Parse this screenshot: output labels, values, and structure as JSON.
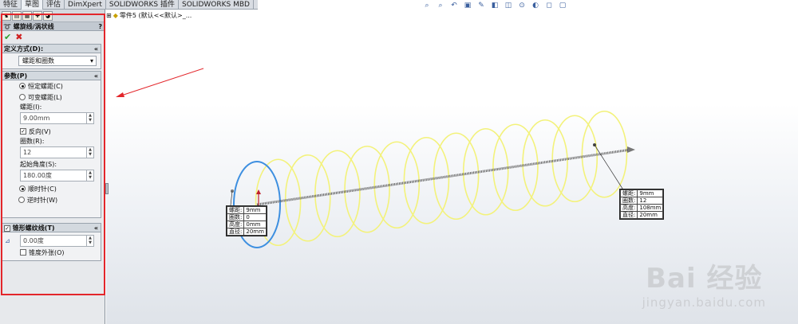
{
  "tabs": [
    "特征",
    "草图",
    "评估",
    "DimXpert",
    "SOLIDWORKS 插件",
    "SOLIDWORKS MBD"
  ],
  "feature_tree_label": "零件5 (默认<<默认>_...",
  "property_manager": {
    "title": "螺旋线/涡状线",
    "help": "?",
    "definition": {
      "header": "定义方式(D):",
      "collapse": "«",
      "selected": "螺距和圈数"
    },
    "params": {
      "header": "参数(P)",
      "collapse": "«",
      "constant_pitch": "恒定螺距(C)",
      "variable_pitch": "可变螺距(L)",
      "pitch_label": "螺距(I):",
      "pitch_value": "9.00mm",
      "reverse": "反向(V)",
      "turns_label": "圈数(R):",
      "turns_value": "12",
      "start_angle_label": "起始角度(S):",
      "start_angle_value": "180.00度",
      "clockwise": "顺时针(C)",
      "counterclockwise": "逆时针(W)"
    },
    "taper": {
      "header": "锥形螺纹线(T)",
      "collapse": "«",
      "angle_value": "0.00度",
      "taper_outward": "锥度外张(O)"
    }
  },
  "callout_start": {
    "rows": [
      [
        "螺距:",
        "9mm"
      ],
      [
        "圈数:",
        "0"
      ],
      [
        "高度:",
        "0mm"
      ],
      [
        "直径:",
        "20mm"
      ]
    ]
  },
  "callout_end": {
    "rows": [
      [
        "螺距:",
        "9mm"
      ],
      [
        "圈数:",
        "12"
      ],
      [
        "高度:",
        "108mm"
      ],
      [
        "直径:",
        "20mm"
      ]
    ]
  },
  "watermark": {
    "main": "Bai 经验",
    "sub": "jingyan.baidu.com"
  },
  "colors": {
    "helix": "#f3f27a",
    "start_circle": "#3d8fe0",
    "annotation": "#e3262b",
    "axis": "#555555"
  }
}
